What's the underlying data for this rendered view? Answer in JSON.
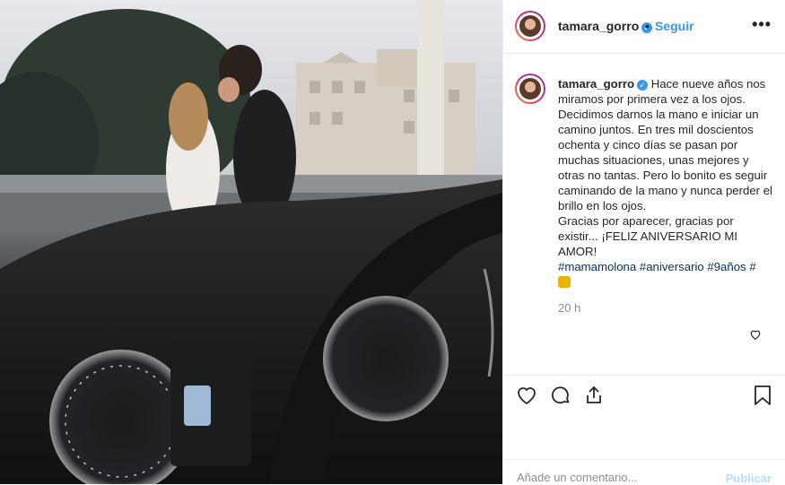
{
  "post": {
    "username": "tamara_gorro",
    "follow_label": "Seguir",
    "separator": "•",
    "more_label": "•••",
    "caption_user": "tamara_gorro",
    "caption_lines": [
      "Hace nueve años nos miramos por primera vez a los ojos.",
      "Decidimos darnos la mano e iniciar un camino juntos. En tres mil doscientos ochenta y cinco días se pasan por muchas situaciones, unas mejores y otras no tantas. Pero lo bonito es seguir caminando de la mano y nunca perder el brillo en los ojos.",
      "Gracias por aparecer, gracias por existir... ¡FELIZ ANIVERSARIO MI AMOR!"
    ],
    "hashtags": "#mamamolona #aniversario #9años #",
    "time": "20 h"
  },
  "comment": {
    "placeholder": "Añade un comentario...",
    "publish_label": "Publicar"
  },
  "icons": {
    "verified": "verified-badge-icon",
    "like": "heart-icon",
    "comment": "comment-icon",
    "share": "share-icon",
    "save": "bookmark-icon"
  },
  "colors": {
    "accent": "#3897f0",
    "text": "#262626",
    "muted": "#8e8e8e",
    "hashtag": "#003569",
    "publish_disabled": "#b2dffc"
  }
}
